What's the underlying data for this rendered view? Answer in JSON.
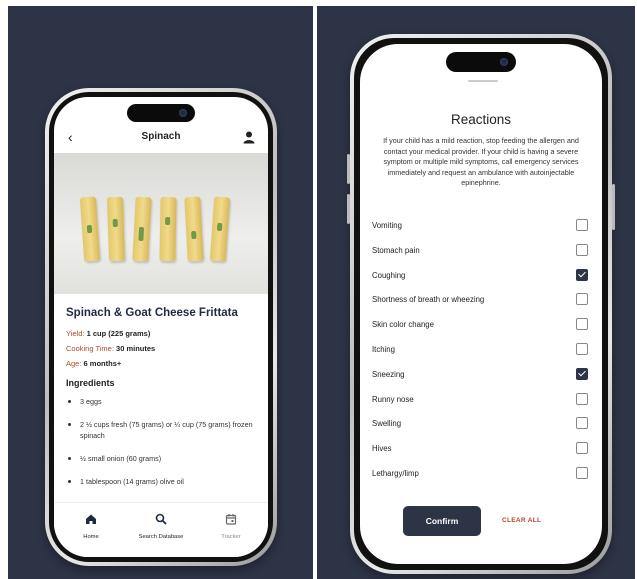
{
  "recipe_screen": {
    "nav_title": "Spinach",
    "recipe_title": "Spinach & Goat Cheese Frittata",
    "yield_label": "Yield:",
    "yield_value": "1 cup (225 grams)",
    "cooking_label": "Cooking Time:",
    "cooking_value": "30 minutes",
    "age_label": "Age:",
    "age_value": "6 months+",
    "ingredients_heading": "Ingredients",
    "ingredients": [
      "3 eggs",
      "2 ½ cups fresh (75 grams) or ¼ cup (75 grams) frozen spinach",
      "½ small onion (60 grams)",
      "1 tablespoon (14 grams) olive oil"
    ],
    "tabs": [
      {
        "label": "Home",
        "icon": "home-icon"
      },
      {
        "label": "Search Database",
        "icon": "search-icon"
      },
      {
        "label": "Tracker",
        "icon": "calendar-icon"
      }
    ]
  },
  "reactions_screen": {
    "title": "Reactions",
    "description": "If your child has a mild reaction, stop feeding the allergen and contact your medical provider. If your child is having a severe symptom or multiple mild symptoms, call emergency services immediately and request an ambulance with autoinjectable epinephrine.",
    "items": [
      {
        "label": "Vomiting",
        "checked": false
      },
      {
        "label": "Stomach pain",
        "checked": false
      },
      {
        "label": "Coughing",
        "checked": true
      },
      {
        "label": "Shortness of breath or wheezing",
        "checked": false
      },
      {
        "label": "Skin color change",
        "checked": false
      },
      {
        "label": "Itching",
        "checked": false
      },
      {
        "label": "Sneezing",
        "checked": true
      },
      {
        "label": "Runny nose",
        "checked": false
      },
      {
        "label": "Swelling",
        "checked": false
      },
      {
        "label": "Hives",
        "checked": false
      },
      {
        "label": "Lethargy/limp",
        "checked": false
      }
    ],
    "confirm_label": "Confirm",
    "clear_label": "CLEAR ALL"
  },
  "colors": {
    "background": "#2d3446",
    "accent": "#b04a2f",
    "primary": "#2d3446"
  }
}
